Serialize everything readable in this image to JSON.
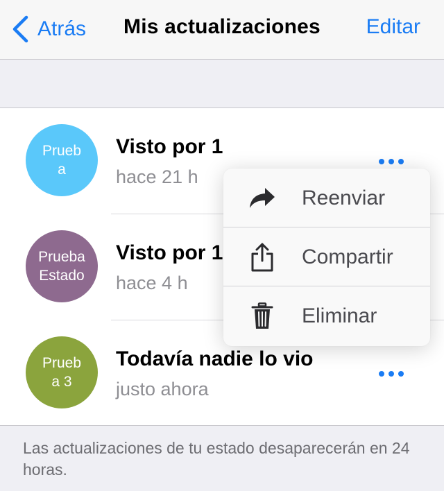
{
  "navbar": {
    "back_label": "Atrás",
    "title": "Mis actualizaciones",
    "edit_label": "Editar"
  },
  "updates": [
    {
      "avatar_text": "Prueb\na",
      "avatar_color": "#5ac8fa",
      "title": "Visto por 1",
      "time": "hace 21 h"
    },
    {
      "avatar_text": "Prueba\nEstado",
      "avatar_color": "#8e6a8f",
      "title": "Visto por 1",
      "time": "hace 4 h"
    },
    {
      "avatar_text": "Prueb\na 3",
      "avatar_color": "#8ba43d",
      "title": "Todavía nadie lo vio",
      "time": "justo ahora"
    }
  ],
  "context_menu": {
    "items": [
      {
        "label": "Reenviar",
        "icon": "forward-icon"
      },
      {
        "label": "Compartir",
        "icon": "share-icon"
      },
      {
        "label": "Eliminar",
        "icon": "trash-icon"
      }
    ]
  },
  "footer_note": "Las actualizaciones de tu estado desaparecerán en 24 horas.",
  "colors": {
    "accent": "#1a7cf4",
    "background": "#efeff4",
    "secondary_text": "#8e8e93"
  }
}
